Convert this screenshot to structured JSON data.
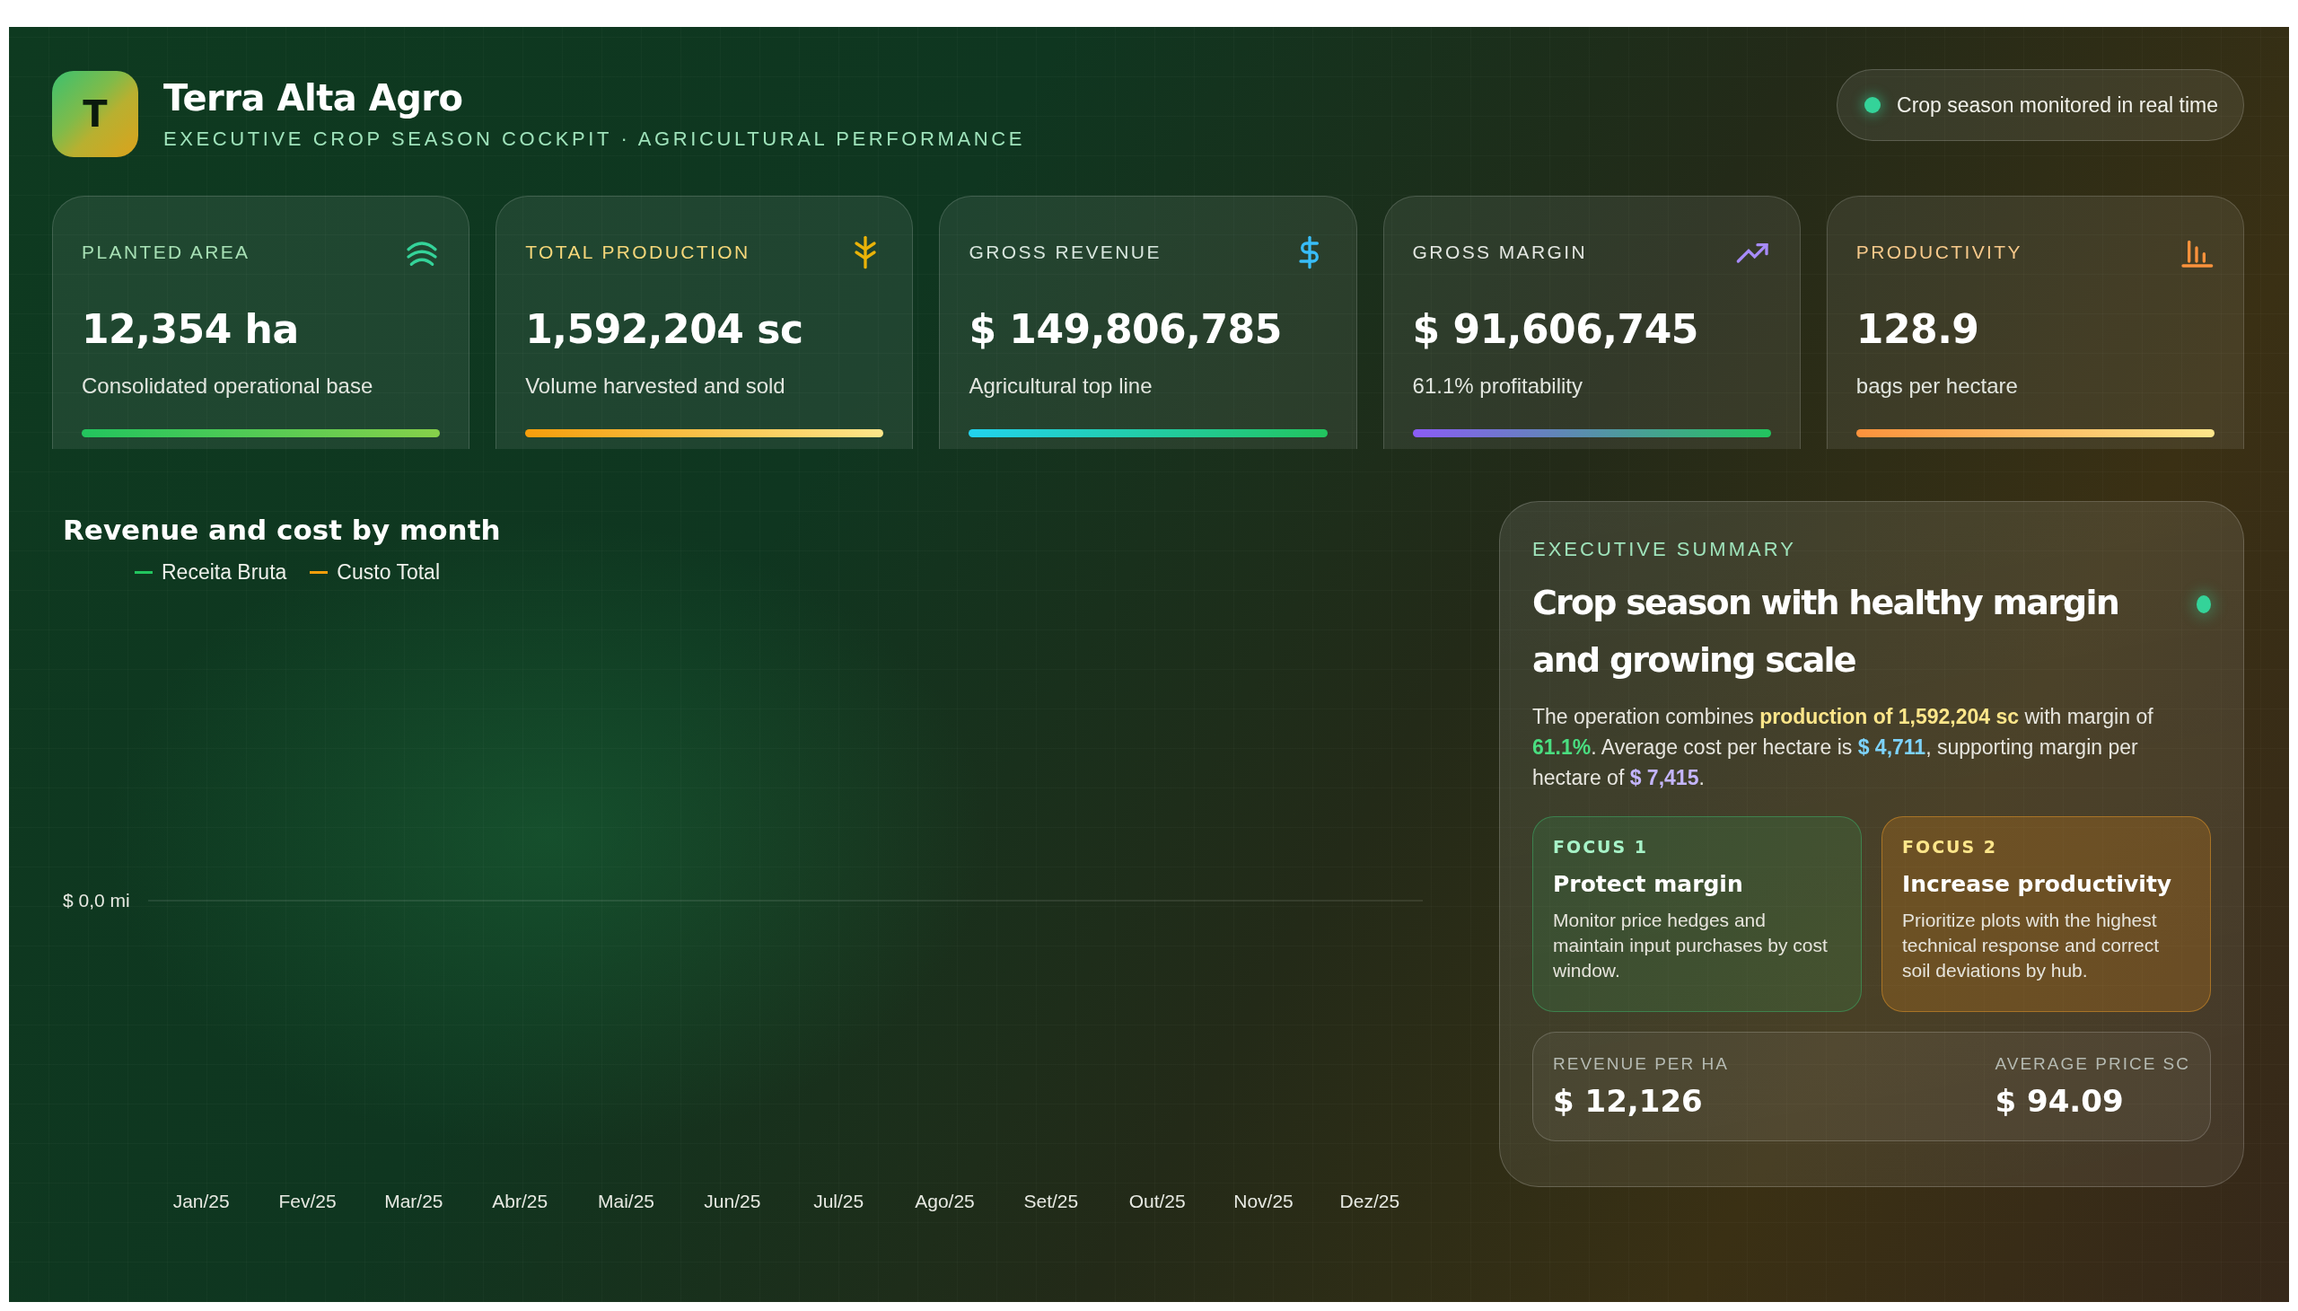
{
  "brand": {
    "logo_letter": "T",
    "name": "Terra Alta Agro",
    "subtitle": "EXECUTIVE CROP SEASON COCKPIT · AGRICULTURAL PERFORMANCE"
  },
  "status_badge": {
    "label": "Crop season monitored in real time",
    "live": true
  },
  "kpis": [
    {
      "kind": "area",
      "label": "PLANTED AREA",
      "value": "12,354 ha",
      "caption": "Consolidated operational base"
    },
    {
      "kind": "production",
      "label": "TOTAL PRODUCTION",
      "value": "1,592,204 sc",
      "caption": "Volume harvested and sold"
    },
    {
      "kind": "revenue",
      "label": "GROSS REVENUE",
      "value": "$ 149,806,785",
      "caption": "Agricultural top line"
    },
    {
      "kind": "margin",
      "label": "GROSS MARGIN",
      "value": "$ 91,606,745",
      "caption": "61.1% profitability"
    },
    {
      "kind": "productivity",
      "label": "PRODUCTIVITY",
      "value": "128.9",
      "caption": "bags per hectare"
    }
  ],
  "chart": {
    "title": "Revenue and cost by month",
    "legend": [
      {
        "name": "Receita Bruta",
        "color": "#22c55e"
      },
      {
        "name": "Custo Total",
        "color": "#f59e0b"
      }
    ],
    "y_axis_label": "$ 0,0 mi",
    "x_labels": [
      "Jan/25",
      "Fev/25",
      "Mar/25",
      "Abr/25",
      "Mai/25",
      "Jun/25",
      "Jul/25",
      "Ago/25",
      "Set/25",
      "Out/25",
      "Nov/25",
      "Dez/25"
    ]
  },
  "summary": {
    "eyebrow": "EXECUTIVE SUMMARY",
    "title": "Crop season with healthy margin and growing scale",
    "live": true,
    "text": "The operation combines **production of 1,592,204 sc** with margin of **61.1%**. Average cost per hectare is **$ 4,711**, supporting margin per hectare of **$ 7,415**.",
    "focus": [
      {
        "kind": "green",
        "label": "FOCUS 1",
        "title": "Protect margin",
        "text": "Monitor price hedges and maintain input purchases by cost window."
      },
      {
        "kind": "amber",
        "label": "FOCUS 2",
        "title": "Increase productivity",
        "text": "Prioritize plots with the highest technical response and correct soil deviations by hub."
      }
    ],
    "stats": [
      {
        "label": "REVENUE PER HA",
        "value": "$ 12,126"
      },
      {
        "label": "AVERAGE PRICE SC",
        "value": "$ 94.09"
      }
    ]
  }
}
